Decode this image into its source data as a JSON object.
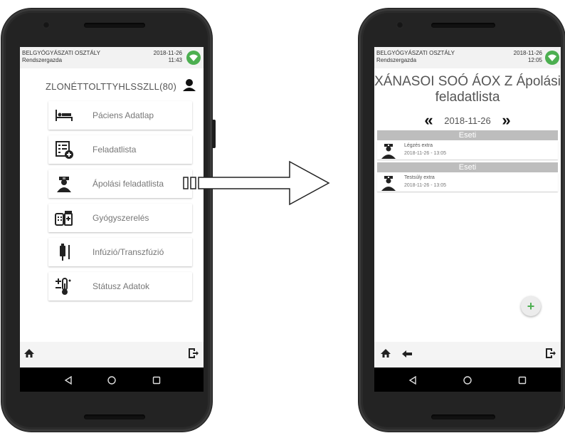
{
  "left_screen": {
    "header": {
      "department": "BELGYÓGYÁSZATI OSZTÁLY",
      "user": "Rendszergazda",
      "date": "2018-11-26",
      "time": "11:43"
    },
    "patient_name": "ZLONÉTTOLTTYHLSSZLL(80)",
    "menu": [
      {
        "label": "Páciens Adatlap",
        "icon": "bed-icon"
      },
      {
        "label": "Feladatlista",
        "icon": "task-list-add-icon"
      },
      {
        "label": "Ápolási feladatlista",
        "icon": "nurse-icon"
      },
      {
        "label": "Gyógyszerelés",
        "icon": "medication-icon"
      },
      {
        "label": "Infúzió/Transzfúzió",
        "icon": "infusion-icon"
      },
      {
        "label": "Státusz Adatok",
        "icon": "thermometer-icon"
      }
    ]
  },
  "right_screen": {
    "header": {
      "department": "BELGYÓGYÁSZATI OSZTÁLY",
      "user": "Rendszergazda",
      "date": "2018-11-26",
      "time": "12:05"
    },
    "title_line1": "XÁNASOI SOÓ ÁOX Z Ápolási",
    "title_line2": "feladatlista",
    "current_date": "2018-11-26",
    "prev_glyph": "«",
    "next_glyph": "»",
    "sections": [
      {
        "header": "Eseti",
        "task": {
          "name": "Légzés extra",
          "time": "2018-11-26 - 13:05"
        }
      },
      {
        "header": "Eseti",
        "task": {
          "name": "Testsúly extra",
          "time": "2018-11-26 - 13:05"
        }
      }
    ],
    "fab_label": "+"
  },
  "colors": {
    "accent_green": "#4caf50",
    "section_grey": "#bdbdbd",
    "phone_body": "#2b2b2b"
  }
}
